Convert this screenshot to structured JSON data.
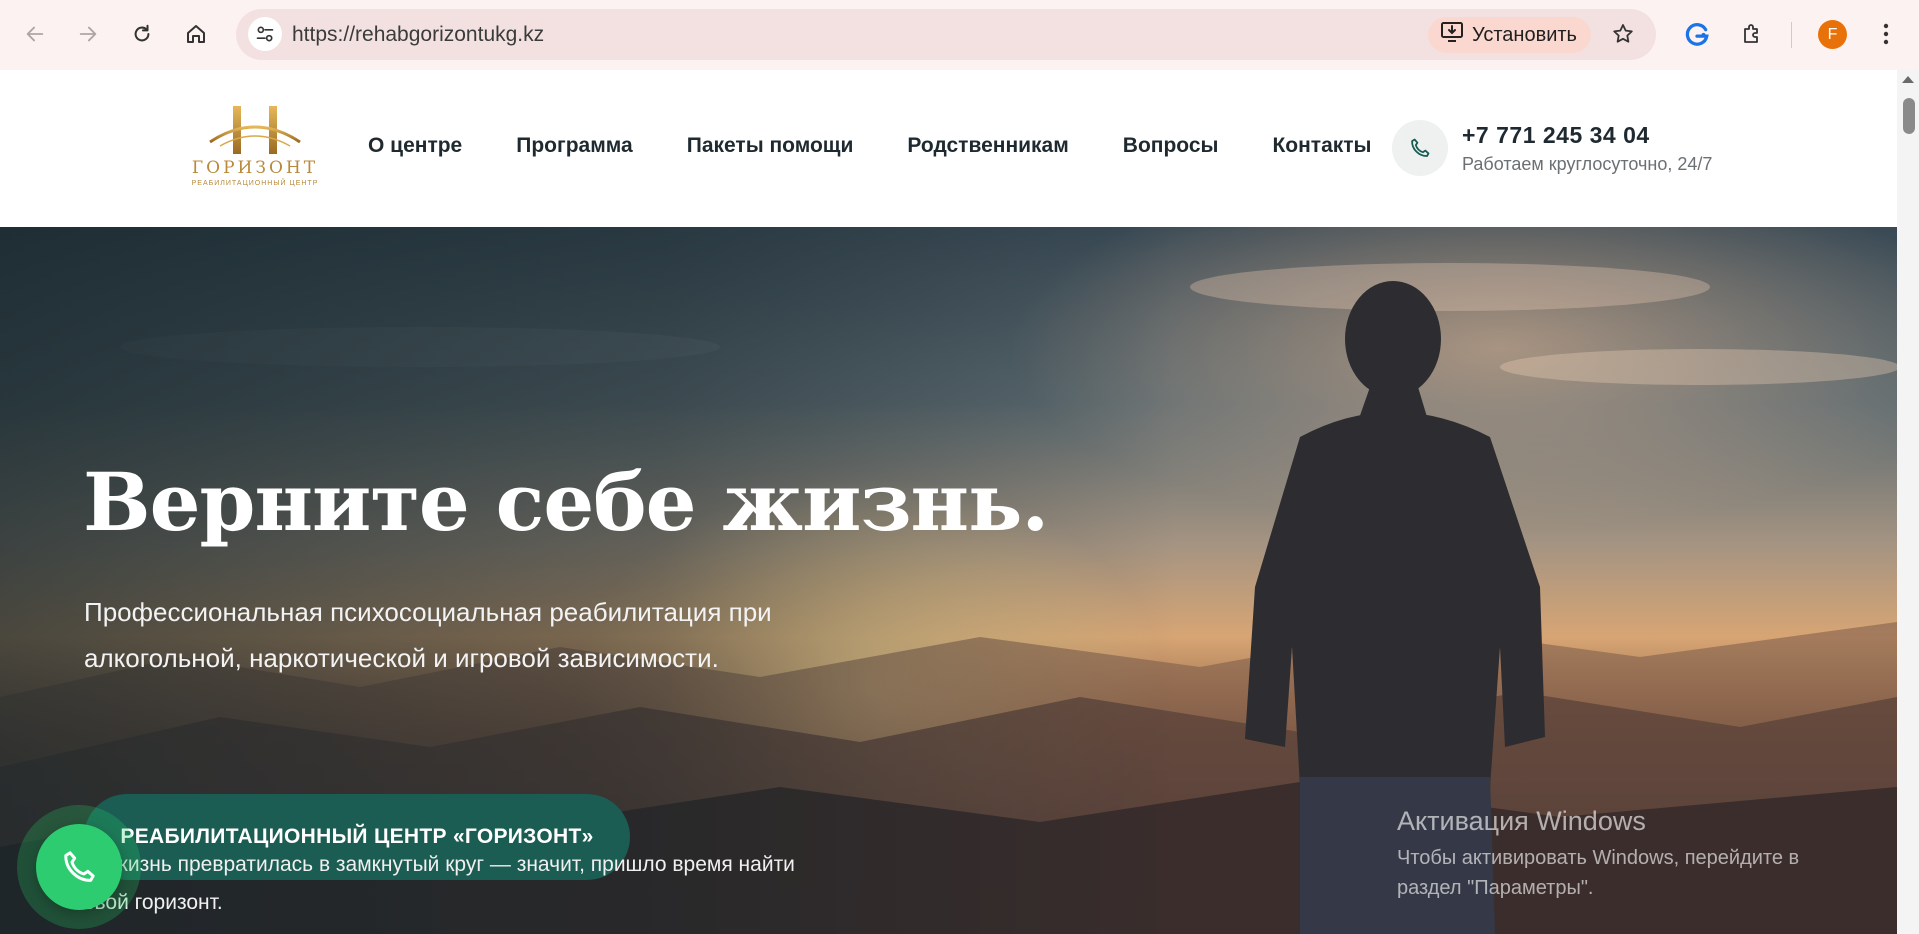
{
  "browser": {
    "url": "https://rehabgorizontukg.kz",
    "install_label": "Установить",
    "profile_initial": "F",
    "icons": [
      "back-arrow-icon",
      "forward-arrow-icon",
      "reload-icon",
      "home-icon",
      "site-settings-icon",
      "install-app-icon",
      "bookmark-star-icon",
      "google-lens-icon",
      "extensions-puzzle-icon",
      "more-vert-icon"
    ]
  },
  "header": {
    "logo": {
      "wordmark": "ГОРИЗОНТ",
      "subline": "РЕАБИЛИТАЦИОННЫЙ ЦЕНТР",
      "color": "#b88a3a"
    },
    "menu": [
      "О центре",
      "Программа",
      "Пакеты помощи",
      "Родственникам",
      "Вопросы",
      "Контакты"
    ],
    "phone": "+7 771 245 34 04",
    "phone_note": "Работаем круглосуточно, 24/7"
  },
  "hero": {
    "title": "Верните себе жизнь.",
    "subtitle": "Профессиональная психосоциальная реабилитация при алкогольной, наркотической и игровой зависимости.",
    "cta_label": "РЕАБИЛИТАЦИОННЫЙ ЦЕНТР «ГОРИЗОНТ»",
    "note": "ли жизнь превратилась в замкнутый круг — значит, пришло время найти свой горизонт.",
    "accent_color": "#1b5c53"
  },
  "watermark": {
    "title": "Активация Windows",
    "text": "Чтобы активировать Windows, перейдите в раздел \"Параметры\"."
  },
  "floating_call": {
    "color": "#2ecc71",
    "icon": "phone-icon"
  }
}
